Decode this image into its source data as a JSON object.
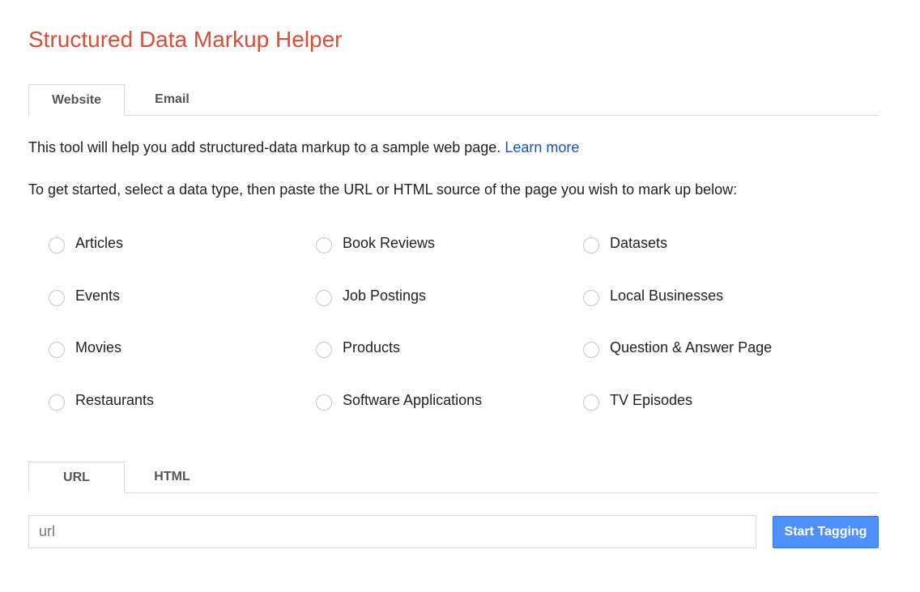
{
  "header": {
    "title": "Structured Data Markup Helper",
    "title_color": "#dd4b39"
  },
  "top_tabs": [
    {
      "label": "Website",
      "active": true
    },
    {
      "label": "Email",
      "active": false
    }
  ],
  "intro": {
    "text": "This tool will help you add structured-data markup to a sample web page. ",
    "link_label": "Learn more",
    "link_color": "#1155cc"
  },
  "instructions": "To get started, select a data type, then paste the URL or HTML source of the page you wish to mark up below:",
  "data_types": [
    {
      "label": "Articles",
      "selected": false
    },
    {
      "label": "Book Reviews",
      "selected": false
    },
    {
      "label": "Datasets",
      "selected": false
    },
    {
      "label": "Events",
      "selected": false
    },
    {
      "label": "Job Postings",
      "selected": false
    },
    {
      "label": "Local Businesses",
      "selected": false
    },
    {
      "label": "Movies",
      "selected": false
    },
    {
      "label": "Products",
      "selected": false
    },
    {
      "label": "Question & Answer Page",
      "selected": false
    },
    {
      "label": "Restaurants",
      "selected": false
    },
    {
      "label": "Software Applications",
      "selected": false
    },
    {
      "label": "TV Episodes",
      "selected": false
    }
  ],
  "source_tabs": [
    {
      "label": "URL",
      "active": true
    },
    {
      "label": "HTML",
      "active": false
    }
  ],
  "url_input": {
    "value": "",
    "placeholder": "url"
  },
  "start_button": {
    "label": "Start Tagging",
    "color": "#4d90fe"
  }
}
